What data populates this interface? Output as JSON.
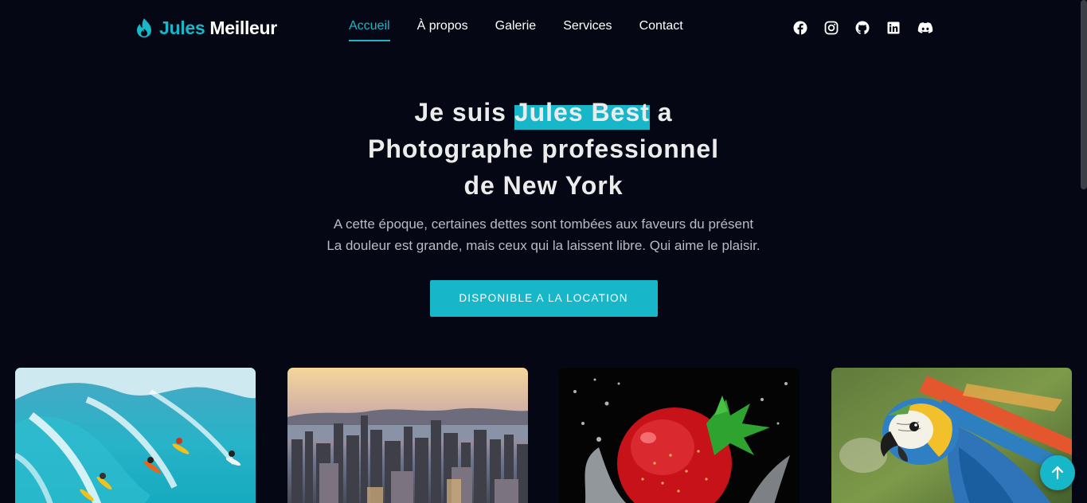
{
  "brand": {
    "first": "Jules",
    "last": "Meilleur"
  },
  "nav": {
    "items": [
      {
        "label": "Accueil",
        "active": true
      },
      {
        "label": "À propos",
        "active": false
      },
      {
        "label": "Galerie",
        "active": false
      },
      {
        "label": "Services",
        "active": false
      },
      {
        "label": "Contact",
        "active": false
      }
    ]
  },
  "social": {
    "icons": [
      "facebook-icon",
      "instagram-icon",
      "github-icon",
      "linkedin-icon",
      "discord-icon"
    ]
  },
  "hero": {
    "title_prefix": "Je suis",
    "title_highlight": "Jules Best",
    "title_suffix": "a",
    "title_line2": "Photographe professionnel",
    "title_line3": "de New York",
    "subtitle_line1": "A cette époque, certaines dettes sont tombées aux faveurs du présent",
    "subtitle_line2": "La douleur est grande, mais ceux qui la laissent libre. Qui aime le plaisir.",
    "cta_label": "DISPONIBLE A LA LOCATION"
  },
  "gallery": {
    "items": [
      "surfers-photo",
      "city-skyline-photo",
      "strawberry-splash-photo",
      "macaw-parrot-photo"
    ]
  },
  "colors": {
    "accent": "#17b6c9",
    "background": "#050814",
    "text_muted": "#b9bcc3"
  }
}
